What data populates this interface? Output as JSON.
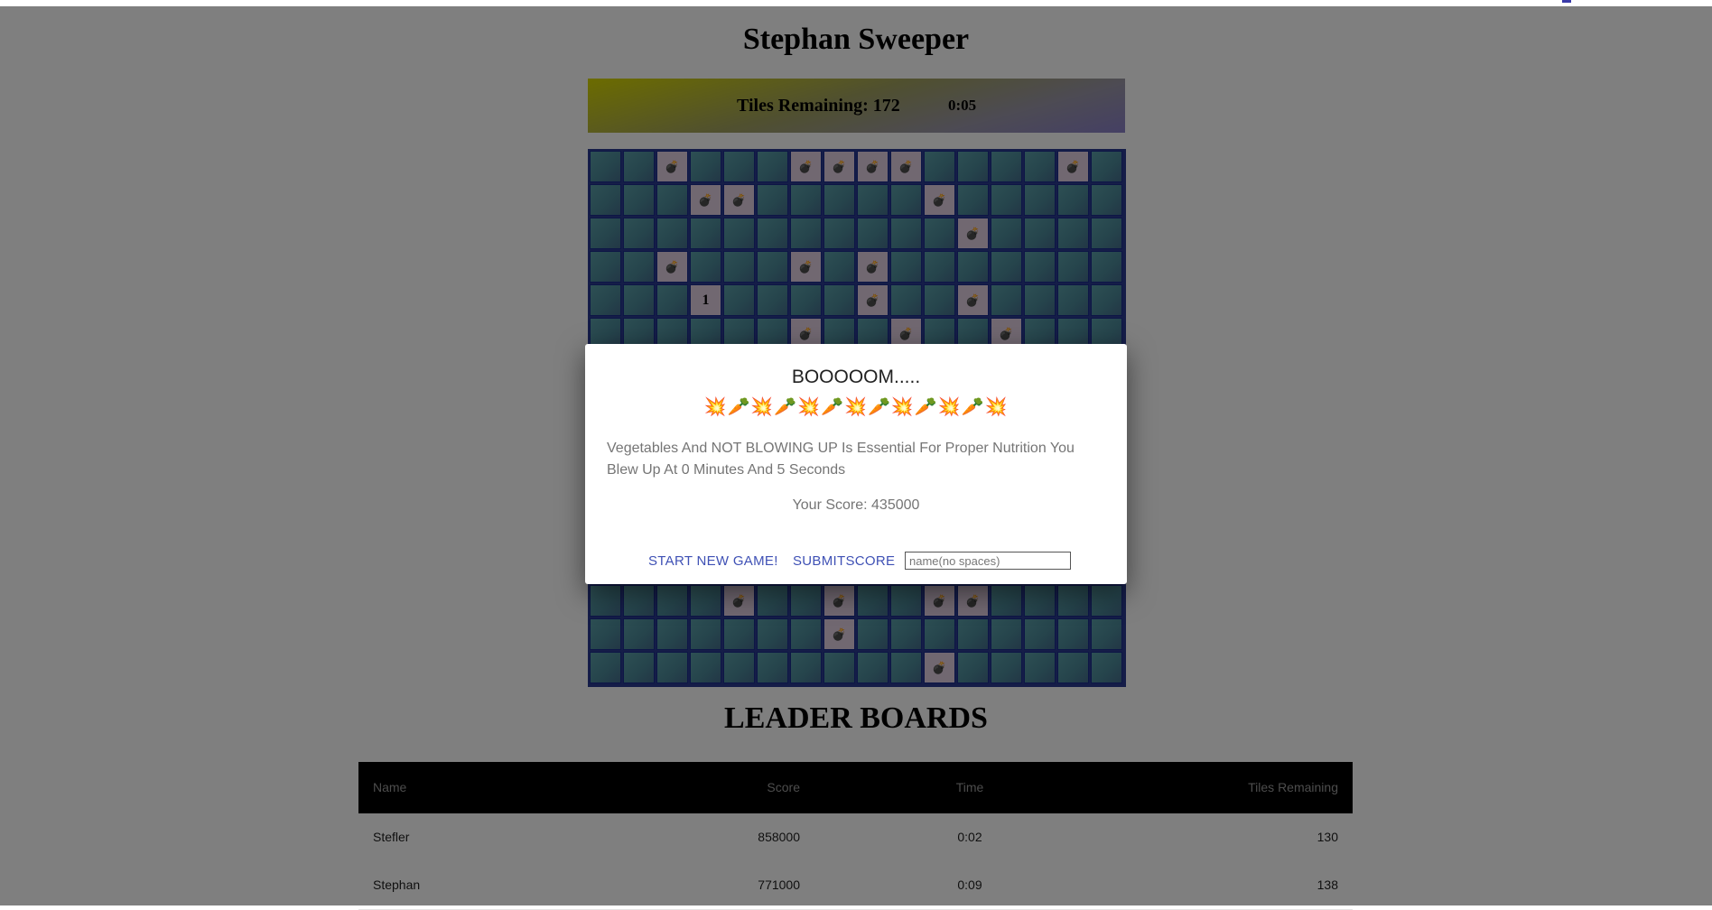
{
  "page": {
    "title": "Stephan Sweeper"
  },
  "status": {
    "tiles_remaining": "Tiles Remaining: 172",
    "timer": "0:05"
  },
  "board": {
    "rows": 16,
    "cols": 16,
    "bomb_icon": "bomb-icon",
    "cells": [
      {
        "r": 0,
        "c": 2,
        "v": "💣"
      },
      {
        "r": 0,
        "c": 6,
        "v": "💣"
      },
      {
        "r": 0,
        "c": 7,
        "v": "💣"
      },
      {
        "r": 0,
        "c": 8,
        "v": "💣"
      },
      {
        "r": 0,
        "c": 9,
        "v": "💣"
      },
      {
        "r": 0,
        "c": 14,
        "v": "💣"
      },
      {
        "r": 1,
        "c": 3,
        "v": "💣"
      },
      {
        "r": 1,
        "c": 4,
        "v": "💣"
      },
      {
        "r": 1,
        "c": 10,
        "v": "💣"
      },
      {
        "r": 2,
        "c": 11,
        "v": "💣"
      },
      {
        "r": 3,
        "c": 2,
        "v": "💣"
      },
      {
        "r": 3,
        "c": 6,
        "v": "💣"
      },
      {
        "r": 3,
        "c": 8,
        "v": "💣"
      },
      {
        "r": 4,
        "c": 3,
        "v": "1"
      },
      {
        "r": 4,
        "c": 8,
        "v": "💣"
      },
      {
        "r": 4,
        "c": 11,
        "v": "💣"
      },
      {
        "r": 5,
        "c": 6,
        "v": "💣"
      },
      {
        "r": 5,
        "c": 9,
        "v": "💣"
      },
      {
        "r": 5,
        "c": 12,
        "v": "💣"
      },
      {
        "r": 13,
        "c": 4,
        "v": "💣"
      },
      {
        "r": 13,
        "c": 7,
        "v": "💣"
      },
      {
        "r": 13,
        "c": 10,
        "v": "💣"
      },
      {
        "r": 13,
        "c": 11,
        "v": "💣"
      },
      {
        "r": 14,
        "c": 7,
        "v": "💣"
      },
      {
        "r": 15,
        "c": 10,
        "v": "💣"
      }
    ]
  },
  "modal": {
    "title": "BOOOOOM.....",
    "emoji": "💥🥕💥🥕💥🥕💥🥕💥🥕💥🥕💥",
    "message": "Vegetables And NOT BLOWING UP Is Essential For Proper Nutrition You Blew Up At 0 Minutes And 5 Seconds",
    "score": "Your Score: 435000",
    "new_game_label": "START NEW GAME!",
    "submit_label": "SUBMITSCORE",
    "name_placeholder": "name(no spaces)"
  },
  "leaderboard": {
    "title": "LEADER BOARDS",
    "columns": [
      "Name",
      "Score",
      "Time",
      "Tiles Remaining"
    ],
    "rows": [
      [
        "Stefler",
        "858000",
        "0:02",
        "130"
      ],
      [
        "Stephan",
        "771000",
        "0:09",
        "138"
      ]
    ]
  }
}
